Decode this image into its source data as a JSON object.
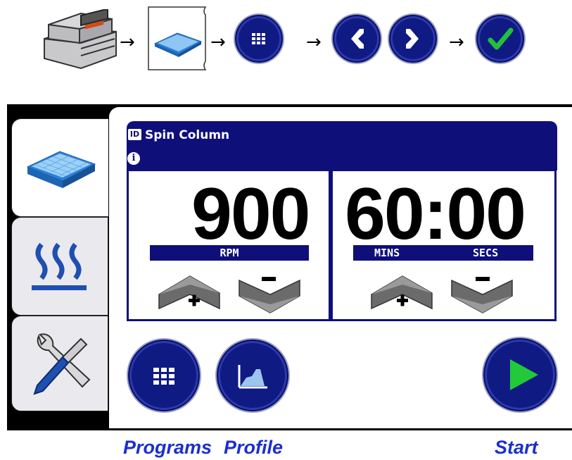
{
  "workflow": {
    "arrow_glyph": "→",
    "steps": [
      "rotor-lid-icon",
      "plate-icon",
      "programs-grid-icon",
      "previous-icon",
      "next-icon",
      "confirm-check-icon"
    ]
  },
  "tabs": [
    {
      "icon": "plate-icon",
      "active": true
    },
    {
      "icon": "heat-icon",
      "active": false
    },
    {
      "icon": "tools-icon",
      "active": false
    }
  ],
  "program": {
    "id_badge": "ID",
    "name": "Spin Column",
    "info_badge": "i"
  },
  "speed": {
    "value": "900",
    "unit_label": "RPM"
  },
  "time": {
    "value": "60:00",
    "minutes_label": "MINS",
    "seconds_label": "SECS"
  },
  "captions": {
    "programs": "Programs",
    "profile": "Profile",
    "start": "Start"
  },
  "colors": {
    "navy": "#0f0f7a",
    "caption_blue": "#1b2fd0",
    "play_green": "#22c93a",
    "check_green": "#1fc23a"
  }
}
